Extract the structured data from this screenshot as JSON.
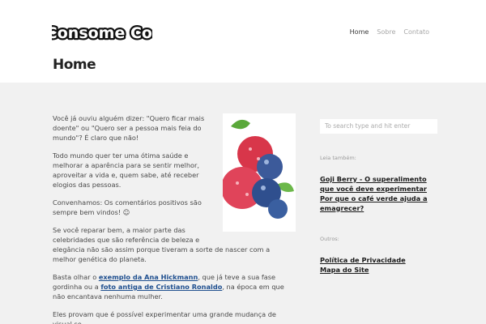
{
  "site": {
    "logo_text": "Consome Co."
  },
  "nav": {
    "items": [
      {
        "label": "Home"
      },
      {
        "label": "Sobre"
      },
      {
        "label": "Contato"
      }
    ]
  },
  "page": {
    "title": "Home"
  },
  "article": {
    "p1": "Você já ouviu alguém dizer: \"Quero ficar mais doente\" ou \"Quero ser a pessoa mais feia do mundo\"? É claro que não!",
    "p2": "Todo mundo quer ter uma ótima saúde e melhorar a aparência para se sentir melhor, aproveitar a vida e, quem sabe, até receber elogios das pessoas.",
    "p3": "Convenhamos: Os comentários positivos são sempre bem vindos!",
    "p4": "Se você reparar bem, a maior parte das celebridades que são referência de beleza e elegância não são assim porque tiveram a sorte de nascer com a melhor genética do planeta.",
    "p5_a": "Basta olhar o ",
    "p5_link1": "exemplo da Ana Hickmann",
    "p5_b": ", que já teve a sua fase gordinha ou a ",
    "p5_link2": "foto antiga de Cristiano Ronaldo",
    "p5_c": ", na época em que não encantava nenhuma mulher.",
    "p6": "Eles provam que é possível experimentar uma grande mudança de visual se"
  },
  "sidebar": {
    "search_placeholder": "To search type and hit enter",
    "also_read_label": "Leia também:",
    "also_read_links": [
      "Goji Berry - O superalimento que você deve experimentar",
      "Por que o café verde ajuda a emagrecer?"
    ],
    "others_label": "Outros:",
    "others_links": [
      "Política de Privacidade",
      "Mapa do Site"
    ]
  },
  "colors": {
    "header_bg": "#ffffff",
    "body_bg": "#f1f1f1",
    "link": "#1f4f8f"
  }
}
